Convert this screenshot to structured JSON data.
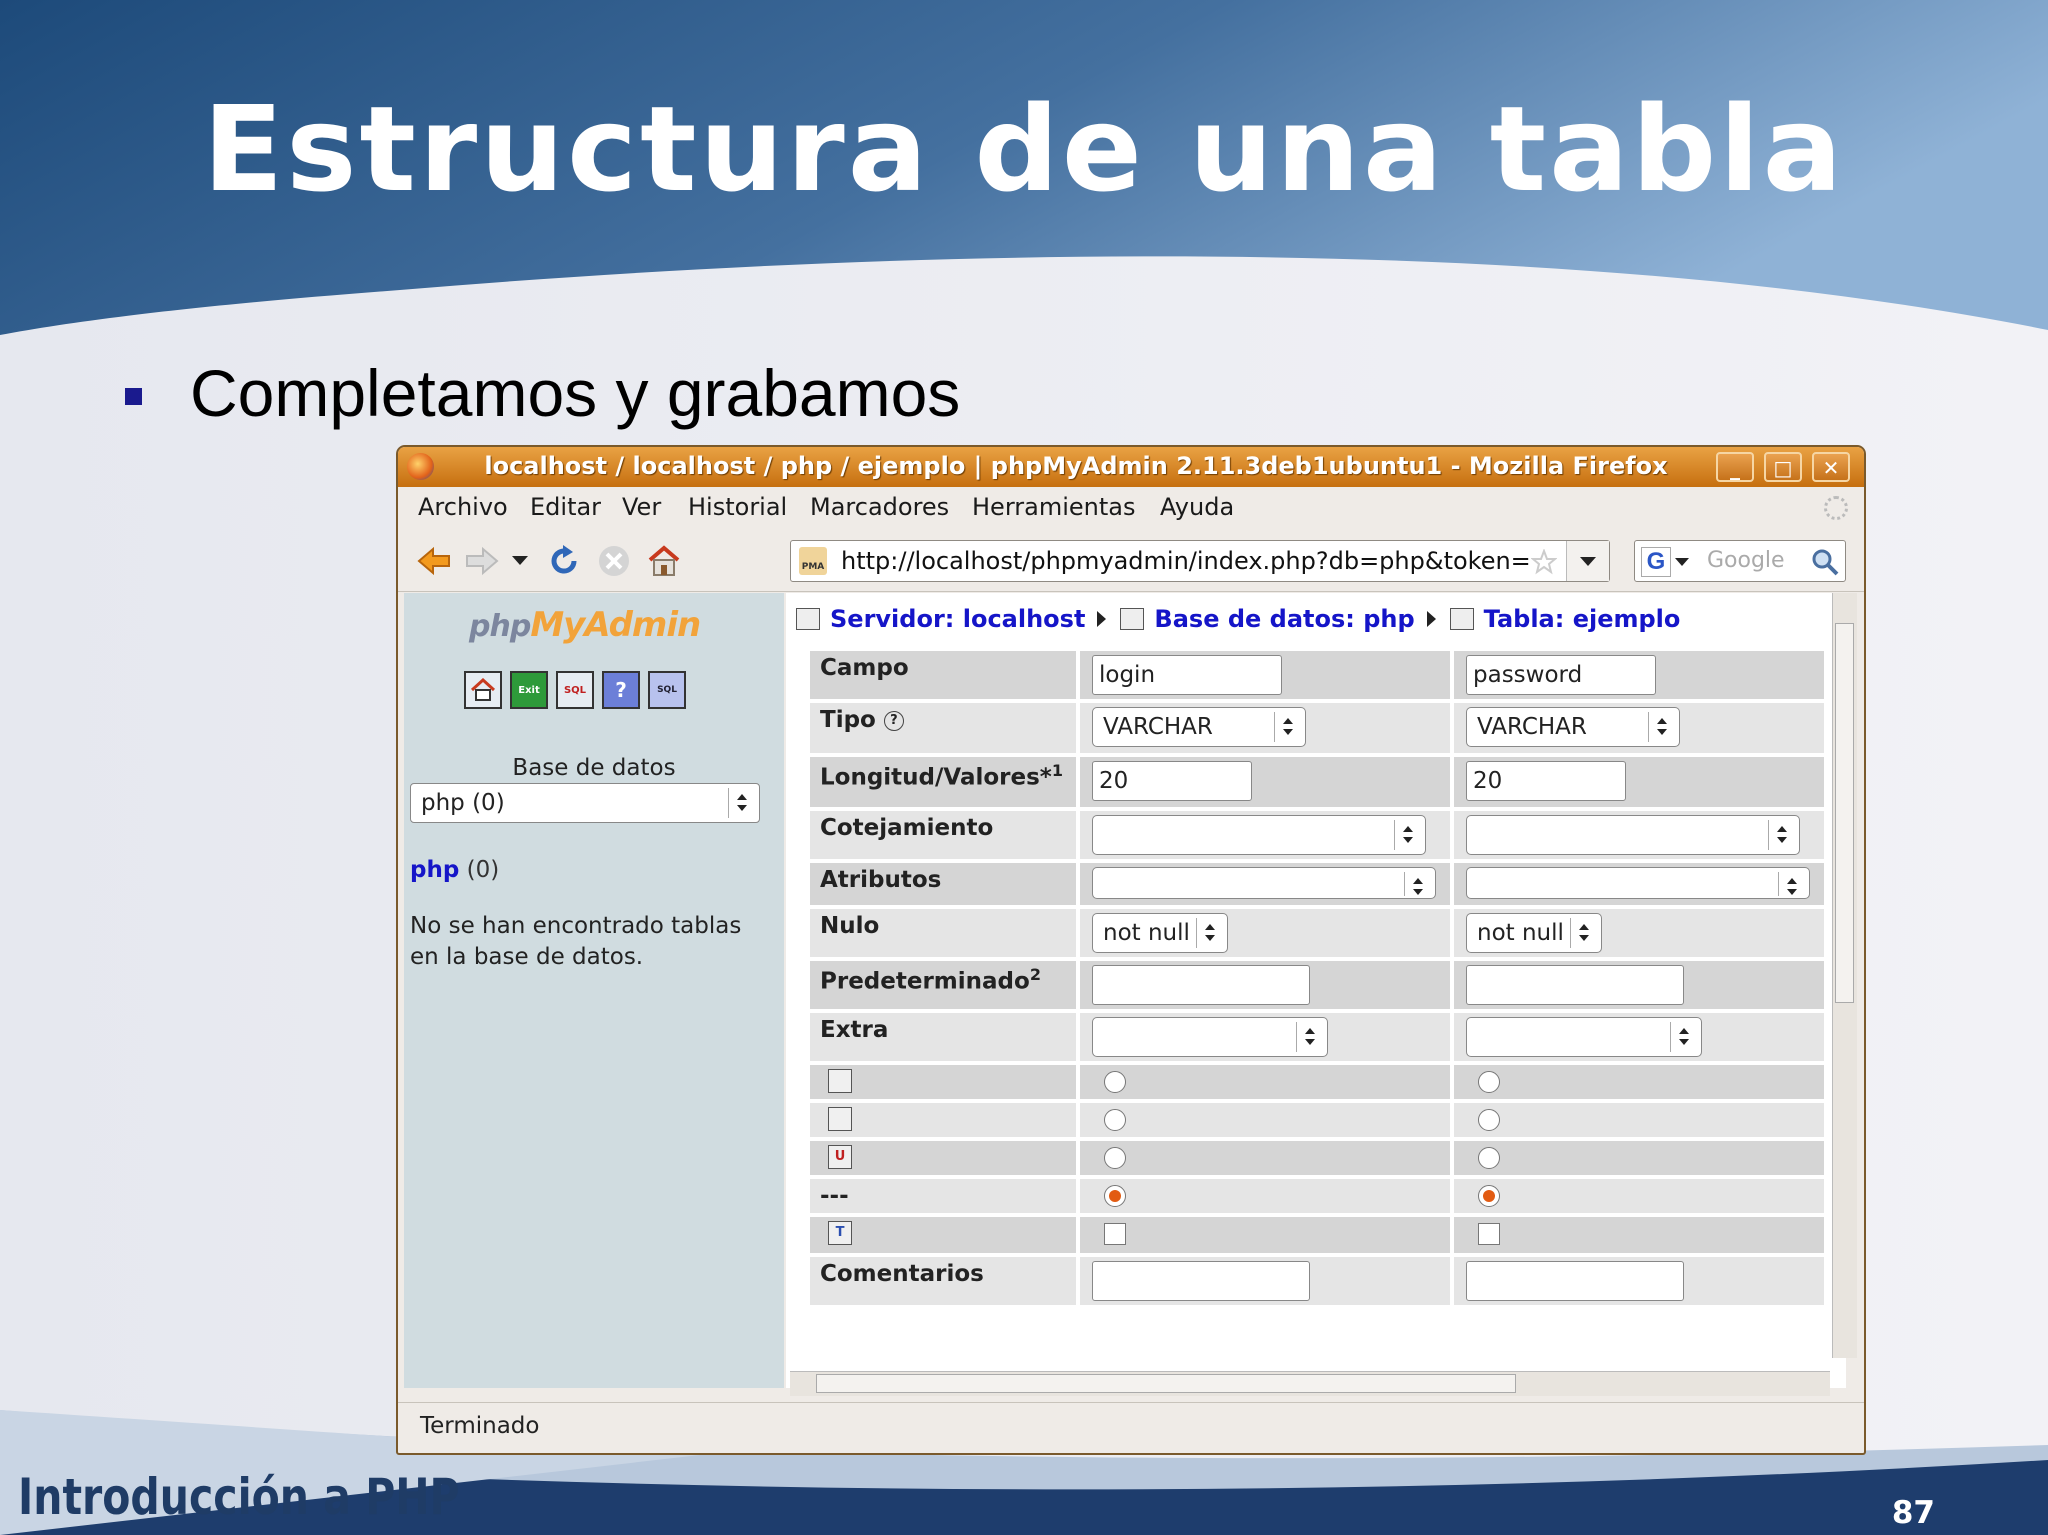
{
  "slide": {
    "title": "Estructura de una tabla",
    "bullet": "Completamos y grabamos",
    "footer": "Introducción a PHP",
    "page_number": "87"
  },
  "window": {
    "title": "localhost / localhost / php / ejemplo | phpMyAdmin 2.11.3deb1ubuntu1 - Mozilla Firefox",
    "controls": {
      "minimize": "_",
      "maximize": "□",
      "close": "✕"
    }
  },
  "menu": [
    "Archivo",
    "Editar",
    "Ver",
    "Historial",
    "Marcadores",
    "Herramientas",
    "Ayuda"
  ],
  "navbar": {
    "url": "http://localhost/phpmyadmin/index.php?db=php&token=",
    "search_placeholder": "Google",
    "search_engine": "G"
  },
  "sidebar": {
    "logo_php": "php",
    "logo_name": "MyAdmin",
    "icon_labels": [
      "Exit",
      "SQL"
    ],
    "db_label": "Base de datos",
    "db_select": "php (0)",
    "db_link": "php",
    "db_count": "(0)",
    "message": "No se han encontrado tablas en la base de datos."
  },
  "breadcrumb": {
    "server": "Servidor: localhost",
    "database": "Base de datos: php",
    "table": "Tabla: ejemplo"
  },
  "form": {
    "labels": {
      "campo": "Campo",
      "tipo": "Tipo",
      "longitud": "Longitud/Valores*",
      "longitud_sup": "1",
      "cotejamiento": "Cotejamiento",
      "atributos": "Atributos",
      "nulo": "Nulo",
      "predeterminado": "Predeterminado",
      "predeterminado_sup": "2",
      "extra": "Extra",
      "none_option": "---",
      "comentarios": "Comentarios"
    },
    "fields": [
      {
        "campo": "login",
        "tipo": "VARCHAR",
        "longitud": "20",
        "nulo": "not null"
      },
      {
        "campo": "password",
        "tipo": "VARCHAR",
        "longitud": "20",
        "nulo": "not null"
      }
    ]
  },
  "status": "Terminado",
  "colors": {
    "accent_blue": "#1515c8",
    "title_bar": "#d17c1e",
    "radio_selected": "#e25b12"
  }
}
